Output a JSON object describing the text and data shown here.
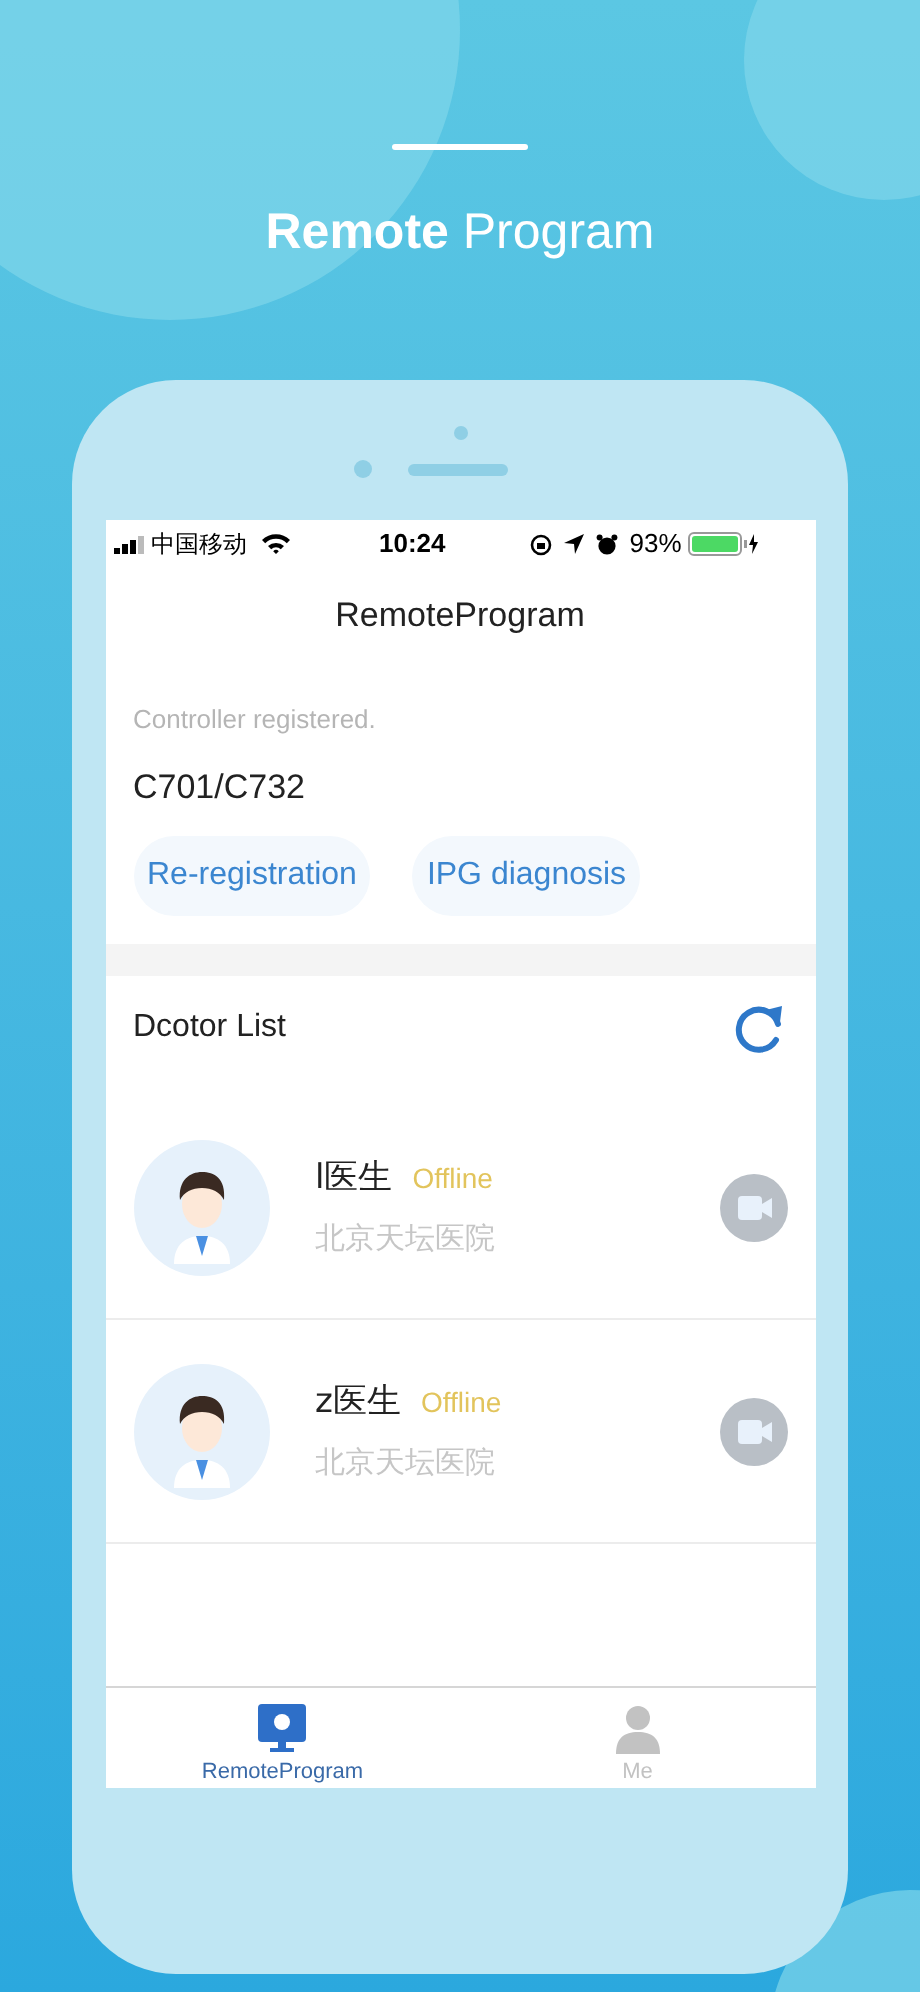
{
  "headline": "**Remote** Program",
  "status_bar": {
    "carrier": "中国移动",
    "time": "10:24",
    "battery": "93%"
  },
  "nav_title": "RemoteProgram",
  "controller": {
    "status": "Controller registered.",
    "model": "C701/C732"
  },
  "actions": [
    "Re-registration",
    "IPG diagnosis"
  ],
  "doctor_list": {
    "title": "Dcotor List",
    "doctors": [
      {
        "name": "l医生",
        "status": "Offline",
        "hospital": "北京天坛医院"
      },
      {
        "name": "z医生",
        "status": "Offline",
        "hospital": "北京天坛医院"
      }
    ]
  },
  "tabs": [
    {
      "label": "RemoteProgram",
      "kind": "monitor",
      "selected": true
    },
    {
      "label": "Me",
      "kind": "person",
      "selected": false
    }
  ]
}
